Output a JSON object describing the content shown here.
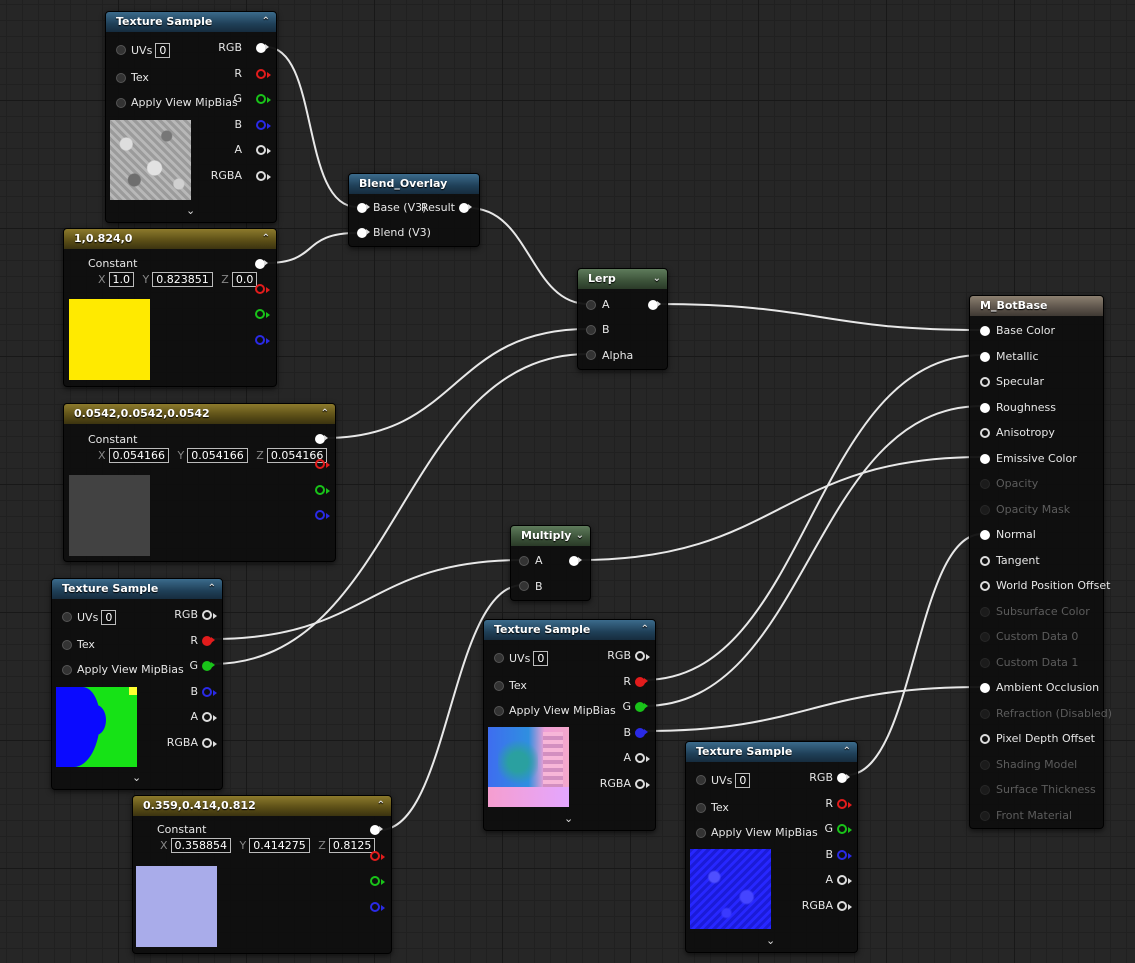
{
  "chev_up": "⌃",
  "chev_down": "⌄",
  "expand": "⌄",
  "nodes": {
    "tex1": {
      "title": "Texture Sample",
      "uvs": "UVs",
      "uvs_value": "0",
      "tex": "Tex",
      "mip": "Apply View MipBias",
      "out": [
        "RGB",
        "R",
        "G",
        "B",
        "A",
        "RGBA"
      ]
    },
    "const1": {
      "title": "1,0.824,0",
      "label": "Constant",
      "x": "1.0",
      "y": "0.823851",
      "z": "0.0",
      "swatch": "#ffea00"
    },
    "const2": {
      "title": "0.0542,0.0542,0.0542",
      "label": "Constant",
      "x": "0.054166",
      "y": "0.054166",
      "z": "0.054166",
      "swatch": "#424242"
    },
    "tex2": {
      "title": "Texture Sample",
      "uvs": "UVs",
      "uvs_value": "0",
      "tex": "Tex",
      "mip": "Apply View MipBias",
      "out": [
        "RGB",
        "R",
        "G",
        "B",
        "A",
        "RGBA"
      ]
    },
    "const3": {
      "title": "0.359,0.414,0.812",
      "label": "Constant",
      "x": "0.358854",
      "y": "0.414275",
      "z": "0.8125",
      "swatch": "#a9acea"
    },
    "blend": {
      "title": "Blend_Overlay",
      "in": [
        "Base (V3)",
        "Blend (V3)"
      ],
      "out": "Result"
    },
    "lerp": {
      "title": "Lerp",
      "in": [
        "A",
        "B",
        "Alpha"
      ]
    },
    "multiply": {
      "title": "Multiply",
      "in": [
        "A",
        "B"
      ]
    },
    "tex3": {
      "title": "Texture Sample",
      "uvs": "UVs",
      "uvs_value": "0",
      "tex": "Tex",
      "mip": "Apply View MipBias",
      "out": [
        "RGB",
        "R",
        "G",
        "B",
        "A",
        "RGBA"
      ]
    },
    "tex4": {
      "title": "Texture Sample",
      "uvs": "UVs",
      "uvs_value": "0",
      "tex": "Tex",
      "mip": "Apply View MipBias",
      "out": [
        "RGB",
        "R",
        "G",
        "B",
        "A",
        "RGBA"
      ]
    },
    "material": {
      "title": "M_BotBase",
      "inputs": [
        {
          "label": "Base Color",
          "state": "connected"
        },
        {
          "label": "Metallic",
          "state": "connected"
        },
        {
          "label": "Specular",
          "state": "open"
        },
        {
          "label": "Roughness",
          "state": "connected"
        },
        {
          "label": "Anisotropy",
          "state": "open"
        },
        {
          "label": "Emissive Color",
          "state": "connected"
        },
        {
          "label": "Opacity",
          "state": "disabled"
        },
        {
          "label": "Opacity Mask",
          "state": "disabled"
        },
        {
          "label": "Normal",
          "state": "connected"
        },
        {
          "label": "Tangent",
          "state": "open"
        },
        {
          "label": "World Position Offset",
          "state": "open"
        },
        {
          "label": "Subsurface Color",
          "state": "disabled"
        },
        {
          "label": "Custom Data 0",
          "state": "disabled"
        },
        {
          "label": "Custom Data 1",
          "state": "disabled"
        },
        {
          "label": "Ambient Occlusion",
          "state": "connected"
        },
        {
          "label": "Refraction (Disabled)",
          "state": "disabled"
        },
        {
          "label": "Pixel Depth Offset",
          "state": "open"
        },
        {
          "label": "Shading Model",
          "state": "disabled"
        },
        {
          "label": "Surface Thickness",
          "state": "disabled"
        },
        {
          "label": "Front Material",
          "state": "disabled"
        }
      ]
    }
  }
}
